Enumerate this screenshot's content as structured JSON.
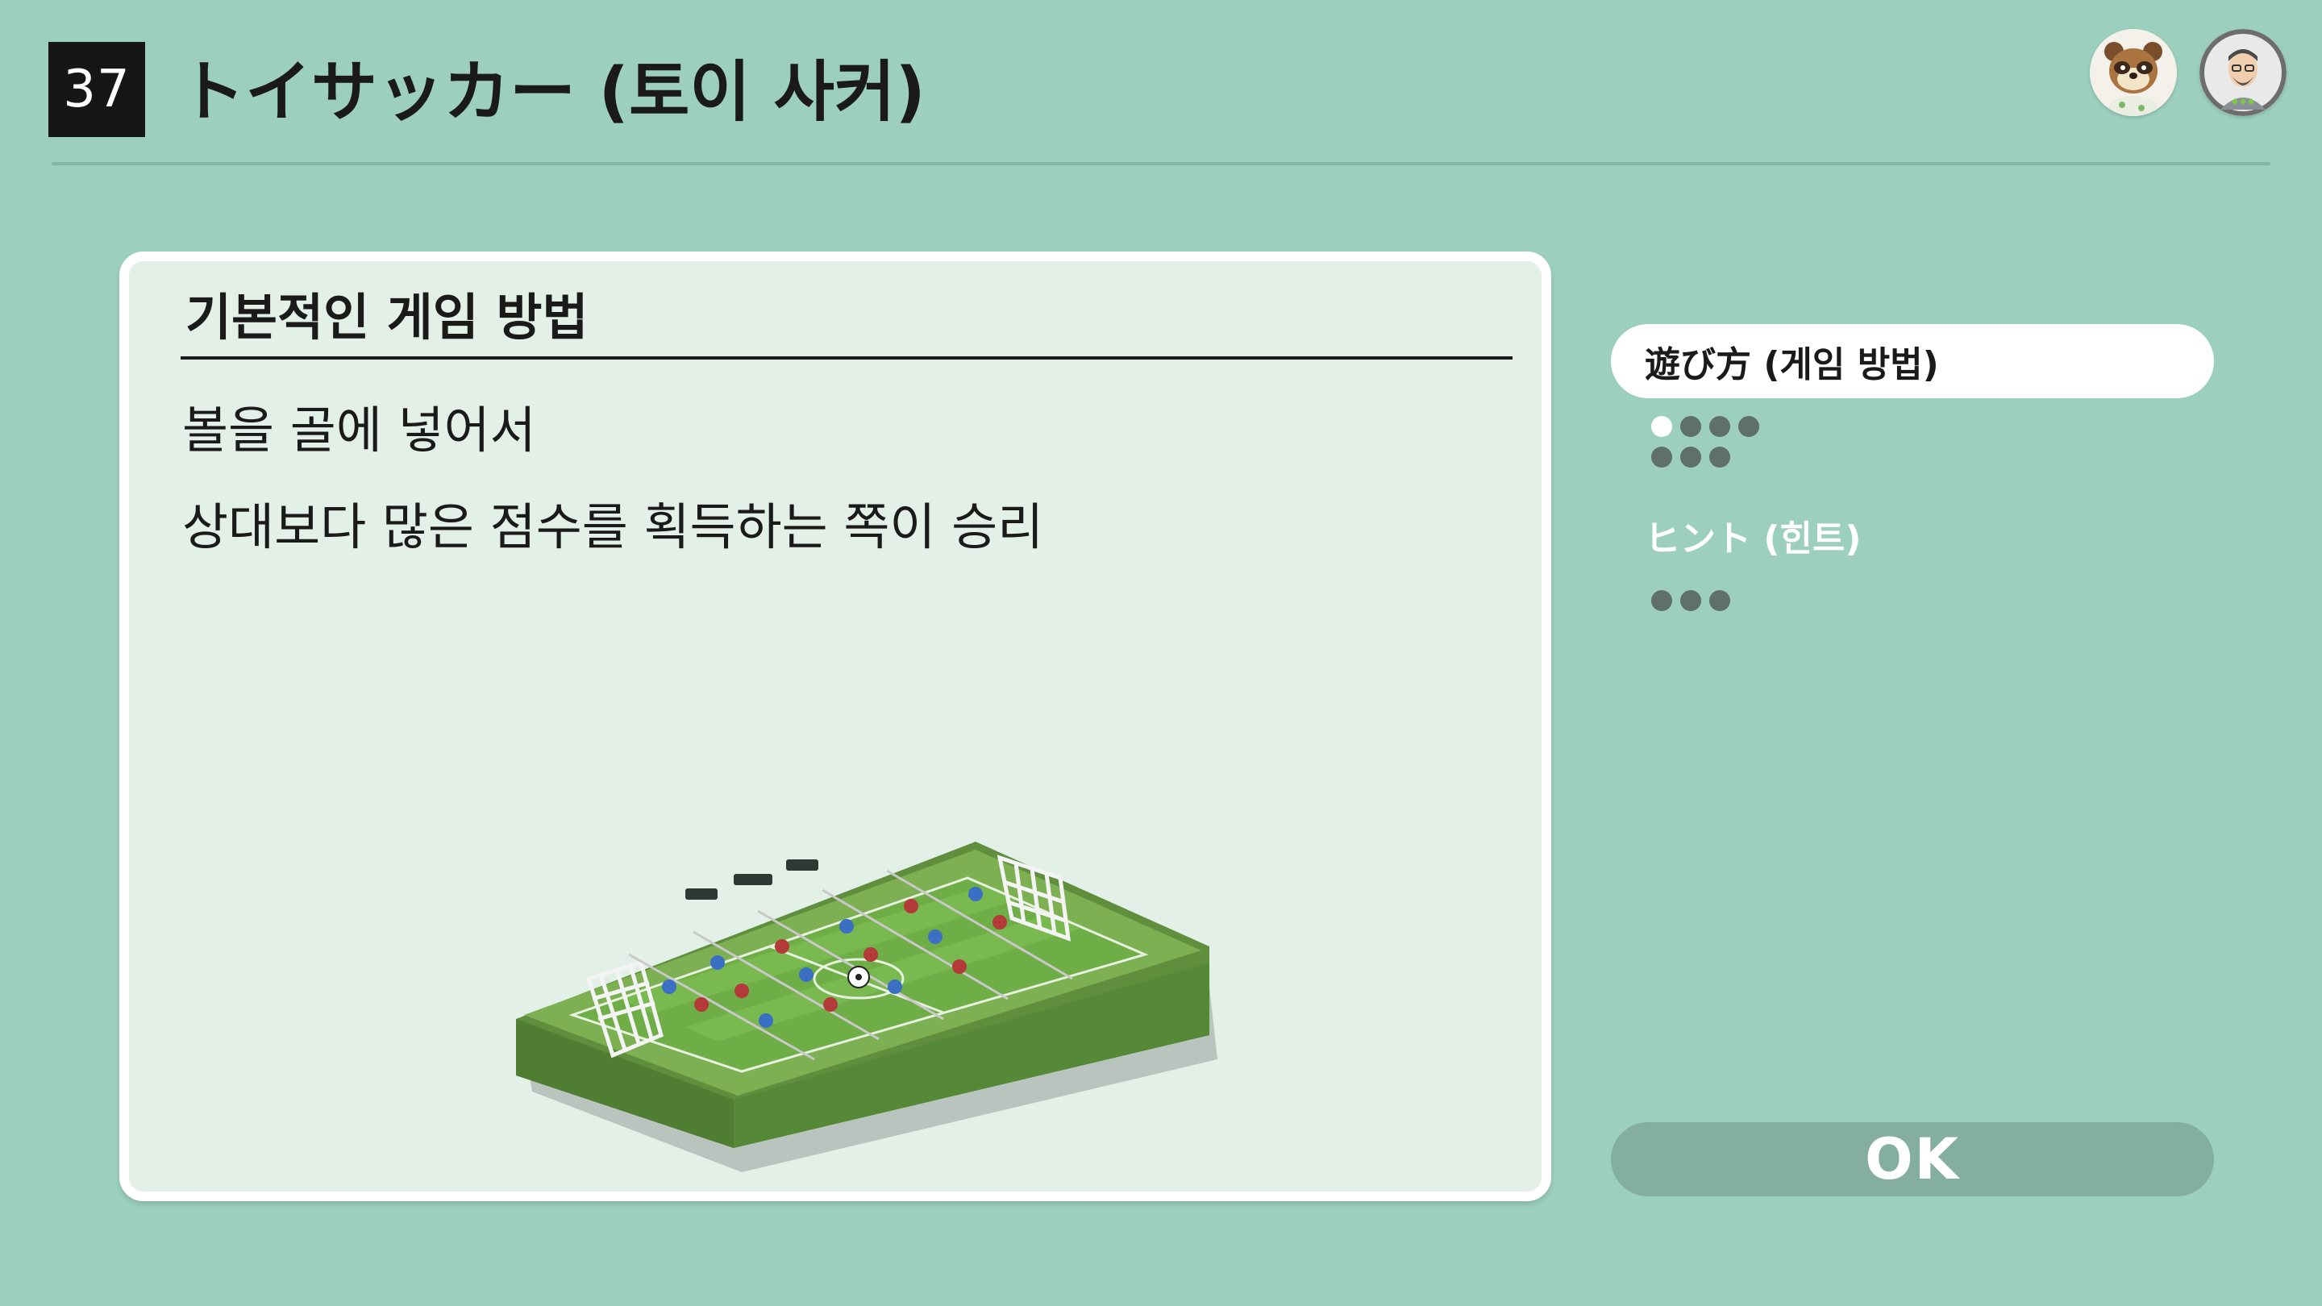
{
  "header": {
    "game_number": "37",
    "title": "トイサッカー (토이 사커)"
  },
  "avatars": [
    {
      "name": "tanuki-character-avatar-icon"
    },
    {
      "name": "player-mii-avatar-icon"
    }
  ],
  "card": {
    "section_title": "기본적인 게임 방법",
    "rules": [
      "볼을 골에 넣어서",
      "상대보다 많은 점수를 획득하는 쪽이 승리"
    ],
    "illustration": "toy-soccer-table-illustration"
  },
  "menu": {
    "items": [
      {
        "label": "遊び方 (게임 방법)",
        "selected": true,
        "page_count": 7,
        "active_page": 1
      },
      {
        "label": "ヒント (힌트)",
        "selected": false,
        "page_count": 3,
        "active_page": 0
      }
    ]
  },
  "ok_button": {
    "label": "OK"
  },
  "colors": {
    "background": "#9ccfbe",
    "card_background": "#e3f0e7",
    "title_box": "#161616",
    "ok_button": "#84ae9f",
    "dot_inactive": "#5f6f69",
    "dot_active": "#ffffff"
  }
}
